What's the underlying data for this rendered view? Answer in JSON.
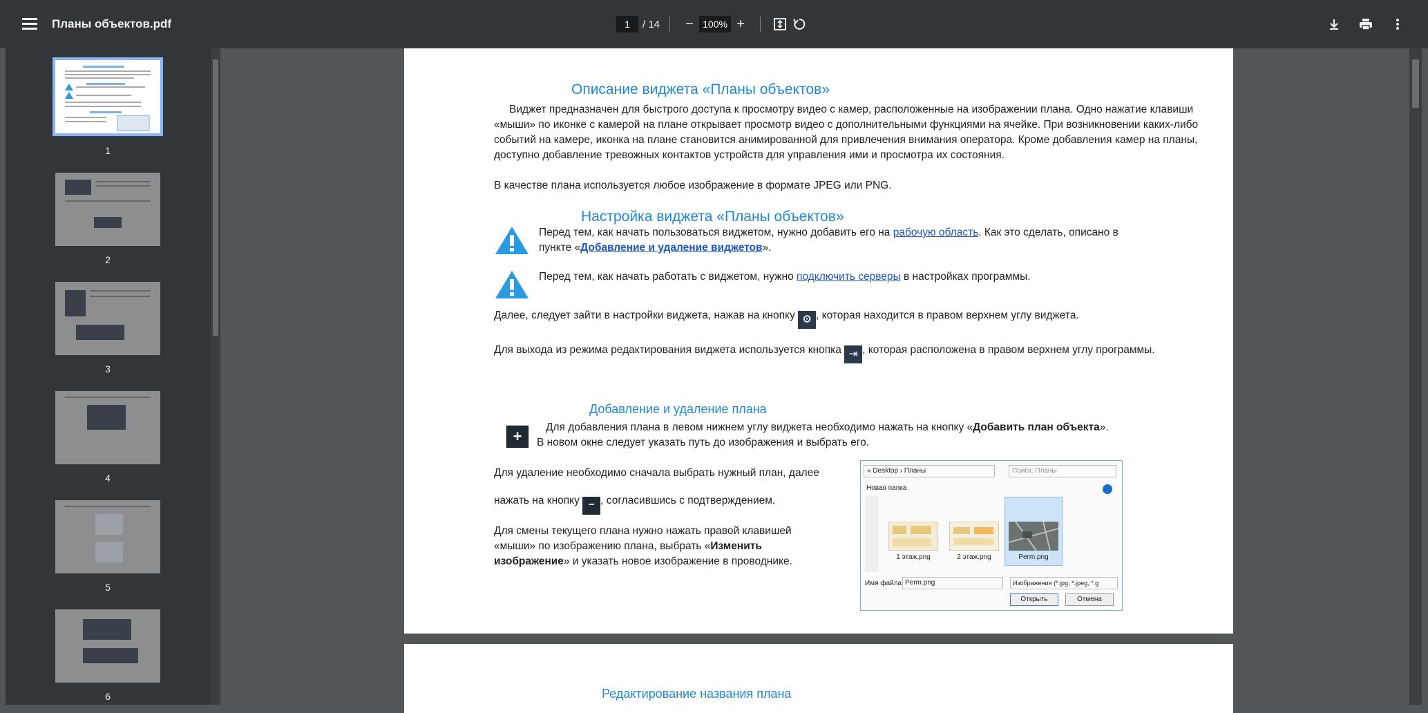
{
  "toolbar": {
    "file_title": "Планы объектов.pdf",
    "page_current": "1",
    "page_total": "/ 14",
    "zoom": "100%"
  },
  "sidebar": {
    "thumbs": [
      {
        "label": "1"
      },
      {
        "label": "2"
      },
      {
        "label": "3"
      },
      {
        "label": "4"
      },
      {
        "label": "5"
      },
      {
        "label": "6"
      }
    ]
  },
  "page1": {
    "h1": "Описание виджета «Планы объектов»",
    "p1": "Виджет предназначен для быстрого доступа к просмотру видео с камер, расположенные на изображении плана. Одно нажатие клавиши «мыши» по иконке с камерой на плане открывает просмотр видео с дополнительными функциями на ячейке. При возникновении каких-либо событий на камере, иконка на плане становится анимированной для привлечения внимания оператора. Кроме добавления камер на планы, доступно добавление тревожных контактов устройств для управления ими и просмотра их состояния.",
    "p2": "В качестве плана используется любое изображение в формате JPEG или PNG.",
    "h2": "Настройка виджета «Планы объектов»",
    "w1_a": "Перед тем, как начать пользоваться виджетом, нужно добавить его на ",
    "w1_link": "рабочую область",
    "w1_b": ". Как это сделать, описано в пункте «",
    "w1_bold": "Добавление и удаление виджетов",
    "w1_c": "».",
    "w2_a": "Перед тем, как начать работать с виджетом, нужно ",
    "w2_link": "подключить серверы",
    "w2_b": " в настройках программы.",
    "p3_a": "Далее, следует зайти в настройки виджета, нажав на кнопку",
    "p3_b": ", которая находится в правом верхнем углу виджета.",
    "p4_a": "Для выхода из режима редактирования виджета используется кнопка",
    "p4_b": ", которая расположена в правом верхнем углу программы.",
    "h3": "Добавление и удаление плана",
    "p5_a": "Для добавления плана в левом нижнем углу виджета необходимо нажать на кнопку «",
    "p5_bold": "Добавить план объекта",
    "p5_b": "».",
    "p5_c": "В новом окне следует указать путь до изображения и выбрать его.",
    "p6_a": "Для удаление необходимо сначала выбрать нужный план, далее",
    "p6_b": "нажать на кнопку",
    "p6_c": ", согласившись с подтверждением.",
    "p7_a": "Для смены текущего плана нужно нажать правой клавишей «мыши» по изображению плана, выбрать «",
    "p7_bold": "Изменить изображение",
    "p7_b": "» и указать новое изображение в проводнике."
  },
  "dialog": {
    "path": "« Desktop › Планы",
    "search": "Поиск: Планы",
    "new_folder": "Новая папка",
    "files": [
      "1 этаж.png",
      "2 этаж.png",
      "Perm.png"
    ],
    "filename_label": "Имя файла:",
    "filename_value": "Perm.png",
    "filetype_value": "Изображения (*.jpg, *.jpeg, *.g",
    "open_btn": "Открыть",
    "cancel_btn": "Отмена"
  },
  "page2": {
    "h1": "Редактирование названия плана"
  }
}
